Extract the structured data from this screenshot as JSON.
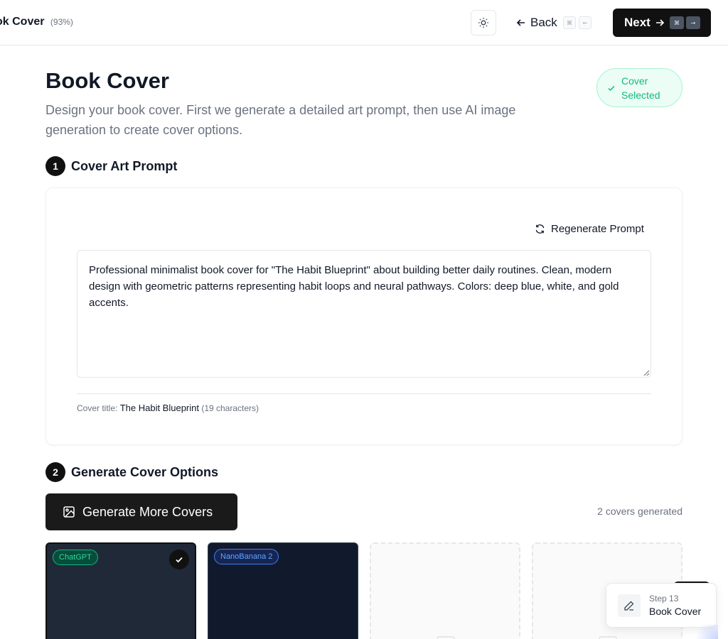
{
  "topbar": {
    "breadcrumb": "ok Cover",
    "progress": "(93%)",
    "back_label": "Back",
    "back_shortcut": [
      "⌘",
      "←"
    ],
    "next_label": "Next",
    "next_shortcut": [
      "⌘",
      "→"
    ]
  },
  "header": {
    "title": "Book Cover",
    "description": "Design your book cover. First we generate a detailed art prompt, then use AI image generation to create cover options.",
    "status_badge": "Cover Selected"
  },
  "section1": {
    "number": "1",
    "title": "Cover Art Prompt",
    "regenerate_label": "Regenerate Prompt",
    "prompt_text": "Professional minimalist book cover for \"The Habit Blueprint\" about building better daily routines. Clean, modern design with geometric patterns representing habit loops and neural pathways. Colors: deep blue, white, and gold accents.",
    "cover_title_label": "Cover title:",
    "cover_title_value": "The Habit Blueprint",
    "cover_title_count": "(19 characters)"
  },
  "section2": {
    "number": "2",
    "title": "Generate Cover Options",
    "generate_label": "Generate More Covers",
    "count_label": "2 covers generated",
    "covers": [
      {
        "provider": "ChatGPT",
        "selected": true
      },
      {
        "provider": "NanoBanana 2",
        "selected": false
      }
    ]
  },
  "toast": {
    "step": "Step 13",
    "title": "Book Cover"
  },
  "colors": {
    "accent": "#111111",
    "success": "#10b981",
    "info": "#60a5fa"
  }
}
